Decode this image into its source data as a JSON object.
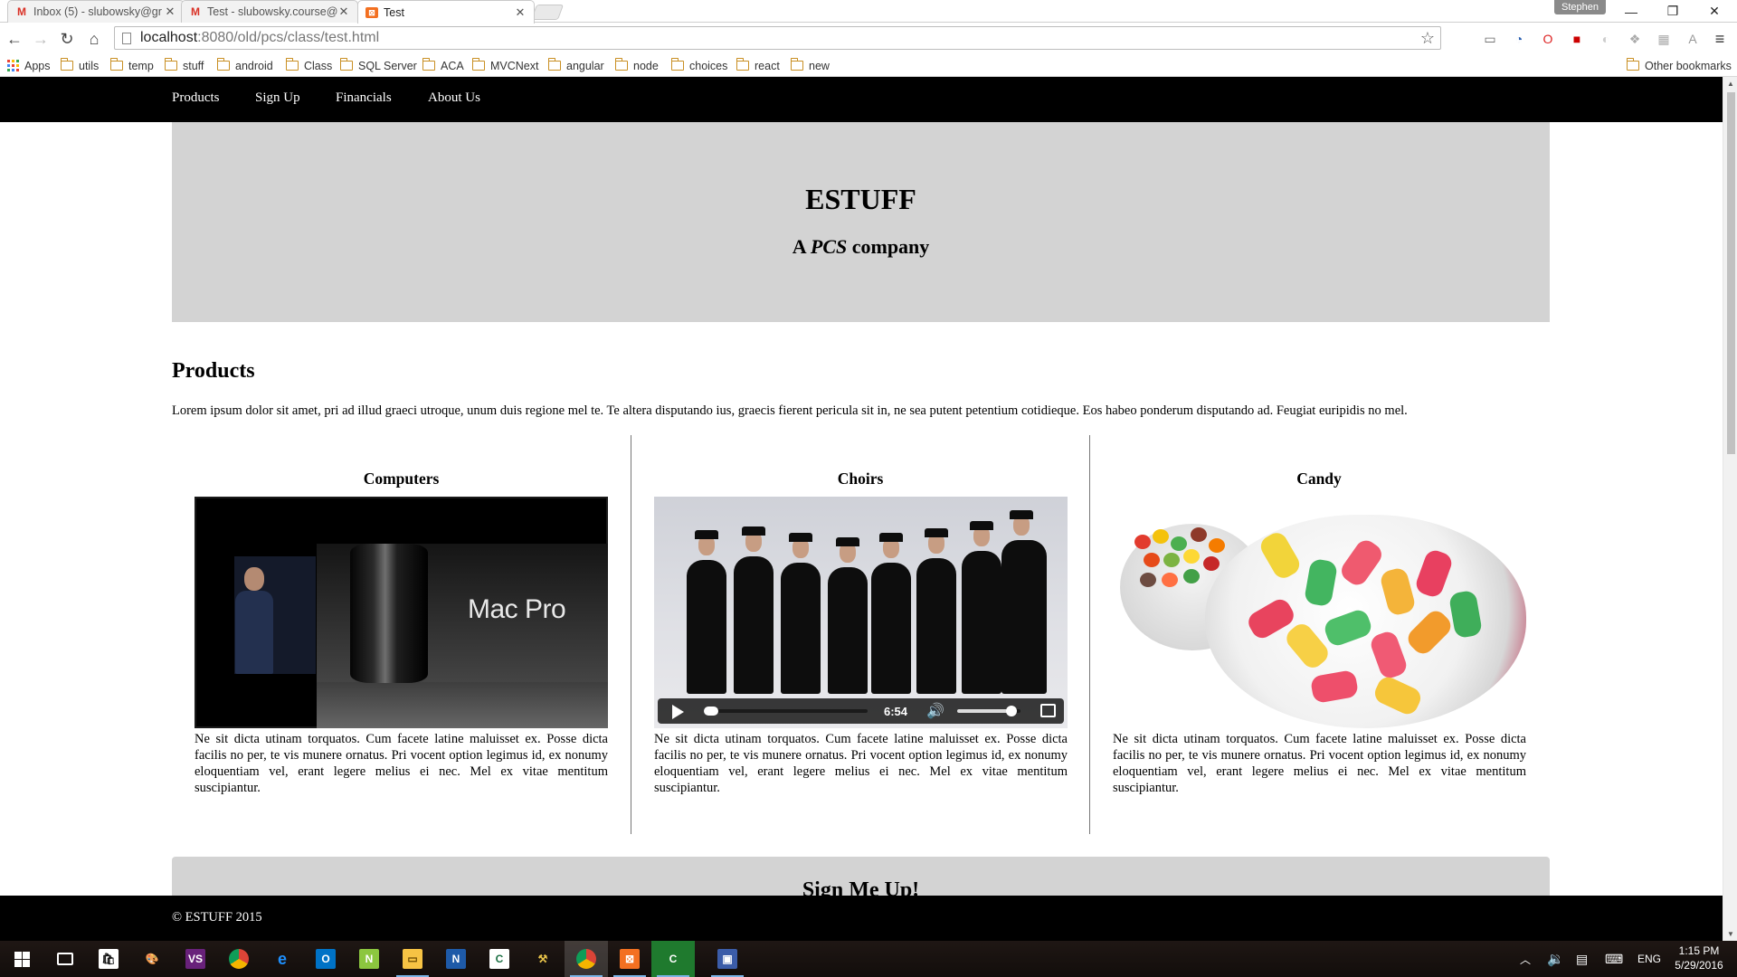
{
  "browser": {
    "tabs": [
      {
        "label": "Inbox (5) - slubowsky@gr",
        "icon": "gmail-icon",
        "active": false
      },
      {
        "label": "Test - slubowsky.course@",
        "icon": "gmail-icon",
        "active": false
      },
      {
        "label": "Test",
        "icon": "xampp-icon",
        "active": true
      }
    ],
    "profile": "Stephen",
    "url_host": "localhost",
    "url_rest": ":8080/old/pcs/class/test.html",
    "bookmarks": [
      "Apps",
      "utils",
      "temp",
      "stuff",
      "android",
      "Class",
      "SQL Server",
      "ACA",
      "MVCNext",
      "angular",
      "node",
      "choices",
      "react",
      "new"
    ],
    "other_bookmarks": "Other bookmarks"
  },
  "site": {
    "nav": [
      "Products",
      "Sign Up",
      "Financials",
      "About Us"
    ],
    "hero_title": "ESTUFF",
    "hero_subtitle_prefix": "A ",
    "hero_subtitle_emph": "PCS",
    "hero_subtitle_suffix": " company",
    "products_heading": "Products",
    "products_intro": "Lorem ipsum dolor sit amet, pri ad illud graeci utroque, unum duis regione mel te. Te altera disputando ius, graecis fierent pericula sit in, ne sea putent petentium cotidieque. Eos habeo ponderum disputando ad. Feugiat euripidis no mel.",
    "columns": [
      {
        "title": "Computers",
        "text": "Ne sit dicta utinam torquatos. Cum facete latine maluisset ex. Posse dicta facilis no per, te vis munere ornatus. Pri vocent option legimus id, ex nonumy eloquentiam vel, erant legere melius ei nec. Mel ex vitae mentitum suscipiantur.",
        "image_text": "Mac Pro"
      },
      {
        "title": "Choirs",
        "text": "Ne sit dicta utinam torquatos. Cum facete latine maluisset ex. Posse dicta facilis no per, te vis munere ornatus. Pri vocent option legimus id, ex nonumy eloquentiam vel, erant legere melius ei nec. Mel ex vitae mentitum suscipiantur.",
        "video_time": "6:54",
        "video_progress": 0.03,
        "video_volume": 0.85
      },
      {
        "title": "Candy",
        "text": "Ne sit dicta utinam torquatos. Cum facete latine maluisset ex. Posse dicta facilis no per, te vis munere ornatus. Pri vocent option legimus id, ex nonumy eloquentiam vel, erant legere melius ei nec. Mel ex vitae mentitum suscipiantur."
      }
    ],
    "signup_heading_partial": "Sign Me Up!",
    "footer": "© ESTUFF 2015"
  },
  "taskbar": {
    "apps": [
      "start-icon",
      "task-view-icon",
      "store-icon",
      "paint-icon",
      "visual-studio-icon",
      "chrome-icon",
      "edge-icon",
      "outlook-icon",
      "notepad-plus-icon",
      "file-explorer-icon",
      "onenote-icon",
      "excel-icon",
      "tools-icon",
      "chrome-running-icon",
      "xampp-icon",
      "camtasia-icon",
      "screen-recorder-icon"
    ],
    "language": "ENG",
    "time": "1:15 PM",
    "date": "5/29/2016"
  },
  "colors": {
    "nav_bg": "#000000",
    "hero_bg": "#d3d3d3",
    "taskbar_bg": "#1a1310"
  }
}
